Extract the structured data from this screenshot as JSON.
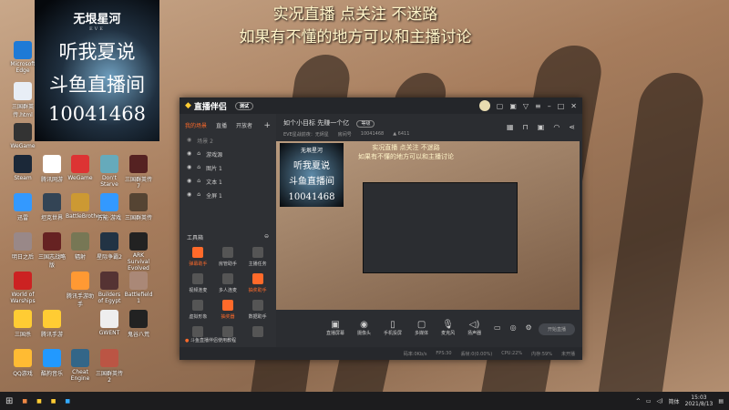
{
  "overlay": {
    "line1": "实况直播 点关注 不迷路",
    "line2": "如果有不懂的地方可以和主播讨论"
  },
  "poster": {
    "logo": "无垠星河",
    "sub": "EVE",
    "line1": "听我夏说",
    "line2": "斗鱼直播间",
    "line3": "10041468"
  },
  "desktop_icons": [
    {
      "label": "Microsoft Edge",
      "color": "#1e7ad6"
    },
    {
      "label": "三国群英传.html",
      "color": "#e8eef6"
    },
    {
      "label": "WeGame",
      "color": "#333"
    },
    {
      "label": "Steam",
      "color": "#1b2838"
    },
    {
      "label": "腾讯网游",
      "color": "#fff"
    },
    {
      "label": "WeGame",
      "color": "#d33"
    },
    {
      "label": "Don't Starve",
      "color": "#6ab"
    },
    {
      "label": "三国群英传7",
      "color": "#522"
    },
    {
      "label": "迅雷",
      "color": "#39f"
    },
    {
      "label": "坦克世界",
      "color": "#345"
    },
    {
      "label": "BattleBrothers",
      "color": "#c93"
    },
    {
      "label": "万能·游戏",
      "color": "#39f"
    },
    {
      "label": "三国群英传",
      "color": "#543"
    },
    {
      "label": "明日之后",
      "color": "#988"
    },
    {
      "label": "三国志战略版",
      "color": "#622"
    },
    {
      "label": "辐射",
      "color": "#775"
    },
    {
      "label": "星际争霸2",
      "color": "#234"
    },
    {
      "label": "ARK Survival Evolved",
      "color": "#222"
    },
    {
      "label": "World of Warships",
      "color": "#c22"
    },
    {
      "label": "腾讯手游助手",
      "color": "#f93"
    },
    {
      "label": "Builders of Egypt",
      "color": "#533"
    },
    {
      "label": "Battlefield 1",
      "color": "#a87"
    },
    {
      "label": "三国杀",
      "color": "#fc3"
    },
    {
      "label": "腾讯手游",
      "color": "#fc3"
    },
    {
      "label": "GWENT",
      "color": "#eee"
    },
    {
      "label": "鬼谷八荒",
      "color": "#222"
    },
    {
      "label": "QQ游戏",
      "color": "#fb3"
    },
    {
      "label": "酷狗音乐",
      "color": "#29f"
    },
    {
      "label": "Cheat Engine",
      "color": "#368"
    },
    {
      "label": "三国群英传2",
      "color": "#b54"
    }
  ],
  "app": {
    "brand": "直播伴侣",
    "version_badge": "测试",
    "tabs": [
      "我的场景",
      "直播",
      "开放者"
    ],
    "scene_label": "场景 2",
    "sources": [
      "游戏源",
      "图片 1",
      "文本 1",
      "全屏 1"
    ],
    "tools_title": "工具箱",
    "tools": [
      "弹幕助手",
      "房管助手",
      "主播任务",
      "视频连麦",
      "多人连麦",
      "抽奖助手",
      "虚拟形象",
      "抽奖器",
      "数据助手",
      "",
      "",
      ""
    ],
    "tip": "斗鱼直播伴侣使用教程",
    "room_title": "如个小目标 先赚一个亿",
    "room_badge": "等级",
    "category": "EVE星战前夜：无烬星",
    "room_label": "房间号",
    "room_id": "10041468",
    "heat": "6411",
    "controls": [
      "直播屏幕",
      "摄像头",
      "手机投屏",
      "多媒体",
      "麦克风",
      "扬声器"
    ],
    "start_button": "开始直播",
    "status": [
      "码率:0Kb/s",
      "FPS:30",
      "丢帧:0(0.00%)",
      "CPU:22%",
      "内存:59%",
      "未开播"
    ]
  },
  "taskbar": {
    "lang": "简体",
    "time": "15:03",
    "date": "2021/8/13"
  }
}
